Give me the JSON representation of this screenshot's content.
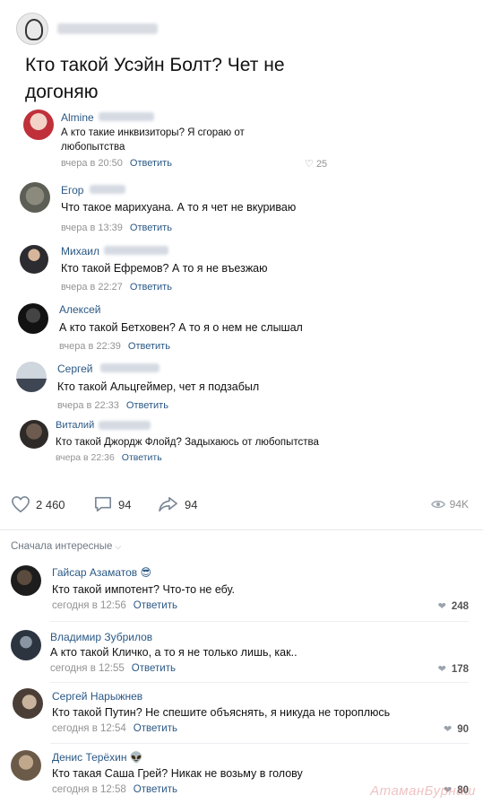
{
  "post": {
    "title": "Кто такой Усэйн Болт? Чет не догоняю"
  },
  "screenshot_comments": [
    {
      "name": "Almine",
      "text": "А кто такие инквизиторы? Я сгораю от любопытства",
      "time": "вчера в 20:50",
      "reply": "Ответить",
      "likes": "25"
    },
    {
      "name": "Егор",
      "text": "Что такое марихуана. А то я чет не вкуриваю",
      "time": "вчера в 13:39",
      "reply": "Ответить"
    },
    {
      "name": "Михаил",
      "text": "Кто такой Ефремов? А то я не въезжаю",
      "time": "вчера в 22:27",
      "reply": "Ответить"
    },
    {
      "name": "Алексей",
      "text": "А кто такой Бетховен? А то я о нем не слышал",
      "time": "вчера в 22:39",
      "reply": "Ответить"
    },
    {
      "name": "Сергей",
      "text": "Кто такой Альцгеймер, чет я подзабыл",
      "time": "вчера в 22:33",
      "reply": "Ответить"
    },
    {
      "name": "Виталий",
      "text": "Кто такой Джордж Флойд? Задыхаюсь от любопытства",
      "time": "вчера в 22:36",
      "reply": "Ответить"
    }
  ],
  "actions": {
    "likes": "2 460",
    "comments": "94",
    "shares": "94",
    "views": "94K"
  },
  "sort": {
    "label": "Сначала интересные"
  },
  "comments": [
    {
      "name": "Гайсар Азаматов",
      "emoji": "😎",
      "text": "Кто такой импотент? Что-то не ебу.",
      "time": "сегодня в 12:56",
      "reply": "Ответить",
      "likes": "248"
    },
    {
      "name": "Владимир Зубрилов",
      "emoji": "",
      "text": "А кто такой Кличко, а то я не только лишь, как..",
      "time": "сегодня в 12:55",
      "reply": "Ответить",
      "likes": "178"
    },
    {
      "name": "Сергей Нарыжнев",
      "emoji": "",
      "text": "Кто такой Путин? Не спешите объяснять, я никуда не тороплюсь",
      "time": "сегодня в 12:54",
      "reply": "Ответить",
      "likes": "90"
    },
    {
      "name": "Денис Терёхин",
      "emoji": "👽",
      "text": "Кто такая Саша Грей? Никак не возьму в голову",
      "time": "сегодня в 12:58",
      "reply": "Ответить",
      "likes": "80"
    }
  ],
  "watermark": "АтаманБурнаш"
}
